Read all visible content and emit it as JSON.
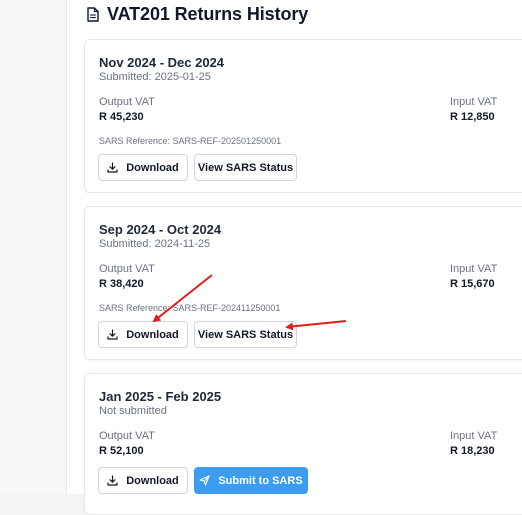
{
  "page": {
    "title": "VAT201 Returns History",
    "icon": "document-icon"
  },
  "labels": {
    "output_vat": "Output VAT",
    "input_vat": "Input VAT"
  },
  "returns": [
    {
      "period": "Nov 2024 - Dec 2024",
      "status": "Submitted: 2025-01-25",
      "output_vat": "R 45,230",
      "input_vat": "R 12,850",
      "reference": "SARS Reference: SARS-REF-202501250001",
      "actions": [
        "Download",
        "View SARS Status"
      ]
    },
    {
      "period": "Sep 2024 - Oct 2024",
      "status": "Submitted: 2024-11-25",
      "output_vat": "R 38,420",
      "input_vat": "R 15,670",
      "reference": "SARS Reference: SARS-REF-202411250001",
      "actions": [
        "Download",
        "View SARS Status"
      ]
    },
    {
      "period": "Jan 2025 - Feb 2025",
      "status": "Not submitted",
      "output_vat": "R 52,100",
      "input_vat": "R 18,230",
      "actions": [
        "Download",
        "Submit to SARS"
      ]
    }
  ],
  "colors": {
    "primary": "#3b9cf0",
    "annotation": "#e11d1d"
  }
}
